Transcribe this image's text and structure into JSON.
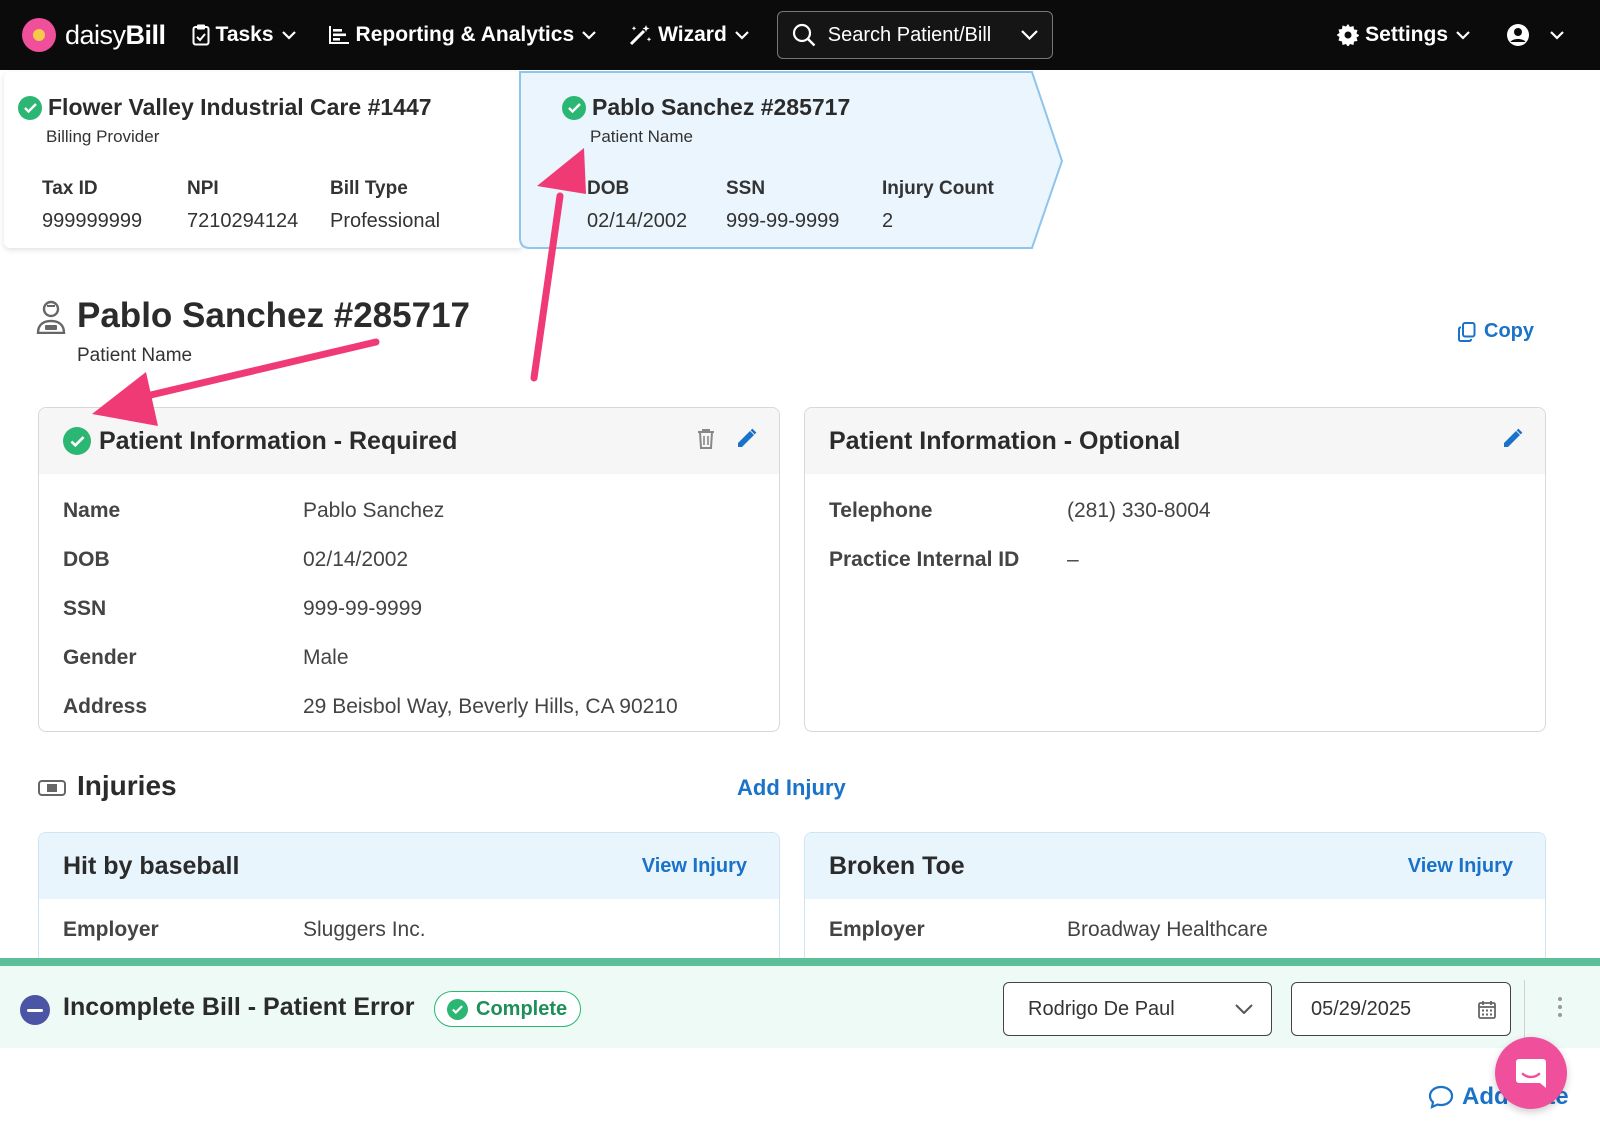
{
  "nav": {
    "brand_light": "daisy",
    "brand_bold": "Bill",
    "items": [
      {
        "label": "Tasks",
        "icon": "clipboard-icon"
      },
      {
        "label": "Reporting & Analytics",
        "icon": "chart-icon"
      },
      {
        "label": "Wizard",
        "icon": "magic-wand-icon"
      }
    ],
    "search_placeholder": "Search Patient/Bill",
    "settings_label": "Settings"
  },
  "crumbs": {
    "provider": {
      "title": "Flower Valley Industrial Care #1447",
      "subtitle": "Billing Provider",
      "fields": [
        {
          "label": "Tax ID",
          "value": "999999999"
        },
        {
          "label": "NPI",
          "value": "7210294124"
        },
        {
          "label": "Bill Type",
          "value": "Professional"
        }
      ]
    },
    "patient": {
      "title": "Pablo Sanchez #285717",
      "subtitle": "Patient Name",
      "fields": [
        {
          "label": "DOB",
          "value": "02/14/2002"
        },
        {
          "label": "SSN",
          "value": "999-99-9999"
        },
        {
          "label": "Injury Count",
          "value": "2"
        }
      ]
    }
  },
  "page": {
    "title": "Pablo Sanchez #285717",
    "subtitle": "Patient Name",
    "copy_label": "Copy"
  },
  "required_card": {
    "title": "Patient Information - Required",
    "rows": [
      {
        "label": "Name",
        "value": "Pablo Sanchez"
      },
      {
        "label": "DOB",
        "value": "02/14/2002"
      },
      {
        "label": "SSN",
        "value": "999-99-9999"
      },
      {
        "label": "Gender",
        "value": "Male"
      },
      {
        "label": "Address",
        "value": "29 Beisbol Way, Beverly Hills, CA 90210"
      }
    ]
  },
  "optional_card": {
    "title": "Patient Information - Optional",
    "rows": [
      {
        "label": "Telephone",
        "value": "(281) 330-8004"
      },
      {
        "label": "Practice Internal ID",
        "value": "–"
      }
    ]
  },
  "injuries": {
    "title": "Injuries",
    "add_label": "Add Injury",
    "items": [
      {
        "title": "Hit by baseball",
        "link": "View Injury",
        "employer_label": "Employer",
        "employer": "Sluggers Inc."
      },
      {
        "title": "Broken Toe",
        "link": "View Injury",
        "employer_label": "Employer",
        "employer": "Broadway Healthcare"
      }
    ]
  },
  "bottom": {
    "status": "Incomplete Bill - Patient Error",
    "badge": "Complete",
    "assignee": "Rodrigo De Paul",
    "date": "05/29/2025",
    "add_note": "Add Note"
  },
  "colors": {
    "accent": "#1a72c9",
    "success": "#2bb673",
    "annotation_arrow": "#f03a76",
    "brand_pink": "#ef4f9b"
  }
}
